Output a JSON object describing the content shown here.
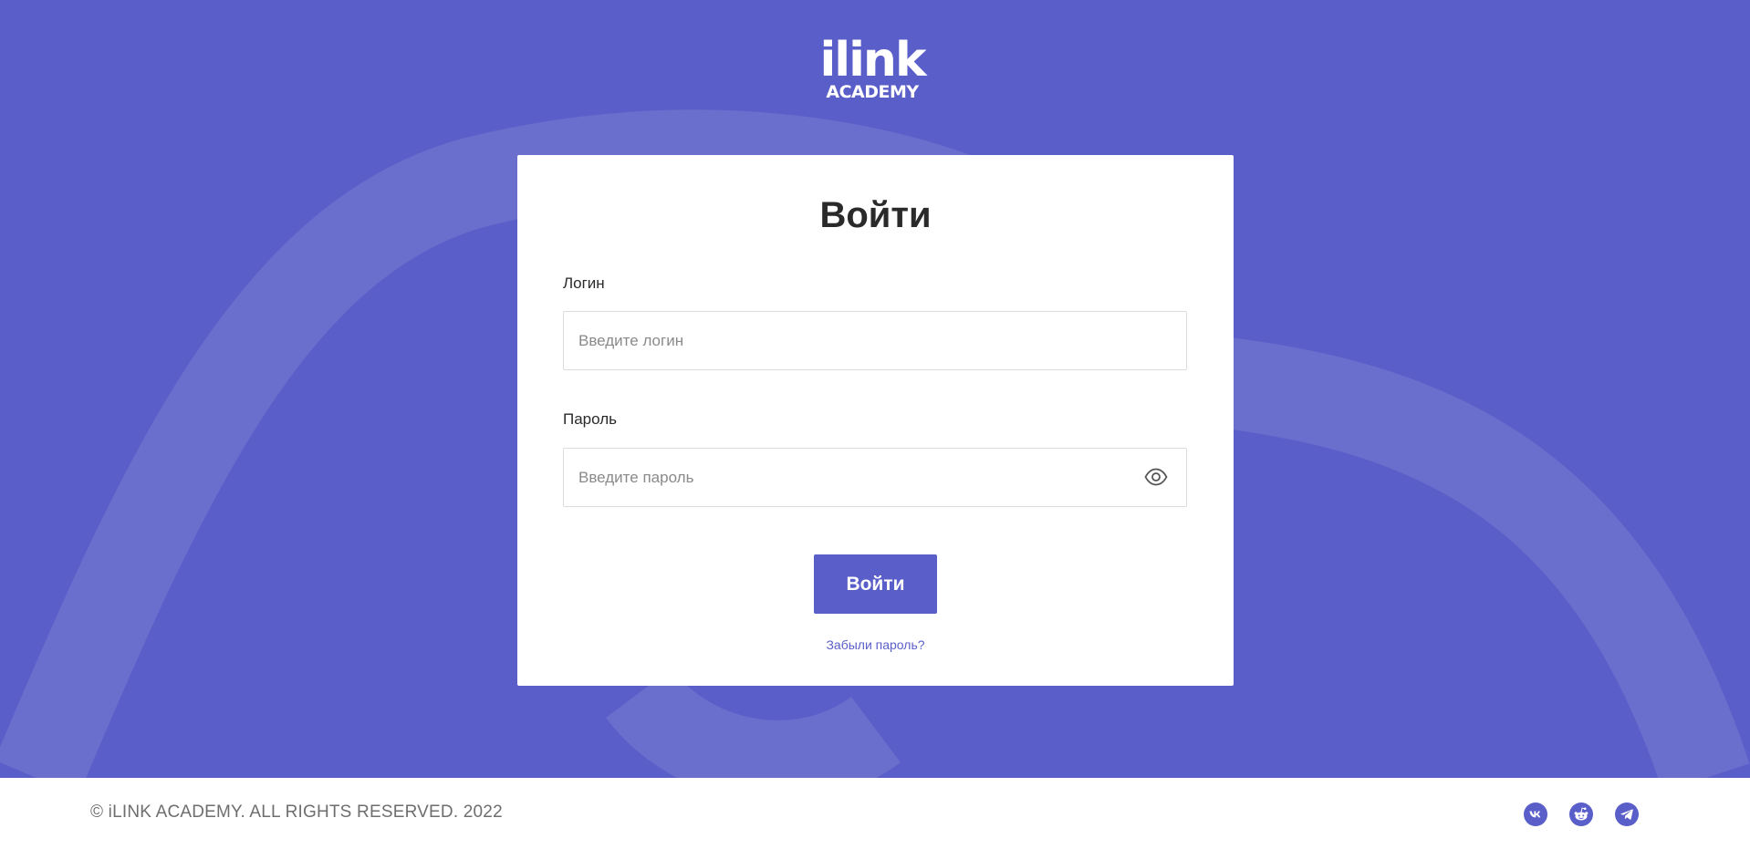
{
  "logo": {
    "line1": "ilink",
    "line2": "ACADEMY"
  },
  "login_form": {
    "title": "Войти",
    "login_label": "Логин",
    "login_placeholder": "Введите логин",
    "login_value": "",
    "password_label": "Пароль",
    "password_placeholder": "Введите пароль",
    "password_value": "",
    "submit_label": "Войти",
    "forgot_link": "Забыли пароль?"
  },
  "footer": {
    "copyright": "© iLINK ACADEMY. ALL RIGHTS RESERVED. 2022",
    "socials": [
      {
        "icon": "vk-icon"
      },
      {
        "icon": "reddit-icon"
      },
      {
        "icon": "telegram-icon"
      }
    ]
  },
  "colors": {
    "brand": "#5a5ec8",
    "background_curve": "#6a6ecd",
    "text_dark": "#2a2a2a",
    "text_muted": "#6e6e6e"
  }
}
